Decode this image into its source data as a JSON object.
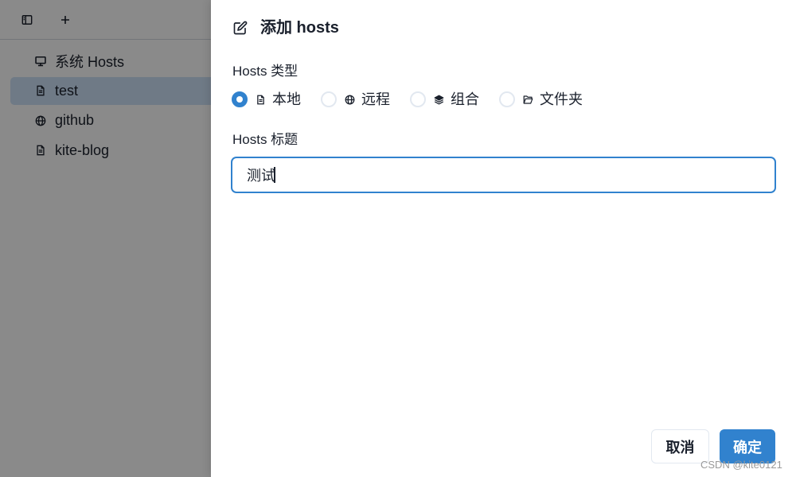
{
  "sidebar": {
    "toolbar": {
      "toggle_icon": "sidebar-toggle-icon",
      "add_icon": "plus-icon"
    },
    "items": [
      {
        "label": "系统 Hosts",
        "icon": "monitor-icon",
        "selected": false
      },
      {
        "label": "test",
        "icon": "file-icon",
        "selected": true
      },
      {
        "label": "github",
        "icon": "globe-icon",
        "selected": false
      },
      {
        "label": "kite-blog",
        "icon": "file-icon",
        "selected": false
      }
    ]
  },
  "drawer": {
    "title_icon": "edit-icon",
    "title": "添加 hosts",
    "type_field": {
      "label": "Hosts 类型",
      "options": [
        {
          "label": "本地",
          "icon": "file-icon",
          "checked": true
        },
        {
          "label": "远程",
          "icon": "globe-icon",
          "checked": false
        },
        {
          "label": "组合",
          "icon": "layers-icon",
          "checked": false
        },
        {
          "label": "文件夹",
          "icon": "folder-open-icon",
          "checked": false
        }
      ]
    },
    "title_field": {
      "label": "Hosts 标题",
      "value": "测试"
    },
    "footer": {
      "cancel_label": "取消",
      "confirm_label": "确定"
    }
  },
  "watermark": {
    "text": "CSDN @kite0121"
  },
  "colors": {
    "accent": "#3182ce",
    "selected_item_bg": "#cde2f7",
    "text": "#1a202c"
  }
}
